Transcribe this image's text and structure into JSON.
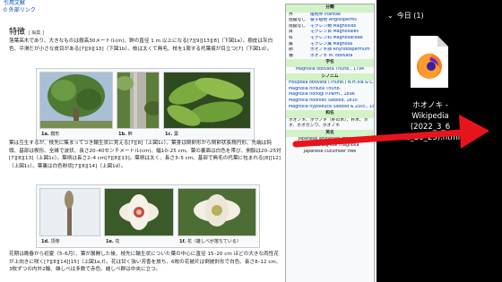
{
  "top_links": [
    "引用文献",
    "0 外部リンク"
  ],
  "section": {
    "title": "特徴",
    "edit": "[ 編集 ]"
  },
  "paragraphs": {
    "p1": "落葉高木であり、大きなものは樹高30メートル(m)、幹の直径 1 m 以上になる[7][9][13][8]（下図1a）。樹皮は灰白色、平滑だが小さな皮目がある[7][9][13]（下図1b）。枝は太くて無毛、枝を1周する托葉痕が目立つ[7]（下図1d）。",
    "p2": "葉は互生するが、枝先に集まってつき輪生状に見える[7][8]（上図1c）。葉身は倒卵形から倒卵状長楕円形、先端は鈍頭、基部は楔形、全縁で波状、長さ20–40センチメートル(cm)、幅10–25 cm。葉の裏面は白色を帯び、側脈は20–25対[7][8][13]（上図1c）。葉柄は長さ2–4 cm[7][8][13]。葉柄は太く、長さ3–5 cm、基部で無毛の托葉に包まれる[8][12]（上図1c）。葉裏は白色粉状[7][8][14]（上図1d）。",
    "p3": "花期は晩春から初夏（5–6月）、葉が展開した後、枝先に輪生状についた葉の中心に直径 15–20 cm ほどの大きな両性花が上向きに咲く[7][8][14][15]（上図1e,f）。花は甘く強い芳香を放ち、6枚の花被片は倒披針形で白色、長さ8–12 cm、3枚ずつの内外2輪、雄しべは多数で赤色、雌しべ群は中央に立つ。"
  },
  "figures_row1": [
    {
      "id": "1a.",
      "label": "樹形"
    },
    {
      "id": "1b.",
      "label": "幹"
    },
    {
      "id": "1c.",
      "label": "葉"
    }
  ],
  "figures_row2": [
    {
      "id": "1d.",
      "label": "頂芽"
    },
    {
      "id": "1e.",
      "label": "花"
    },
    {
      "id": "1f.",
      "label": "花（雄しべが落ちている）"
    }
  ],
  "infobox": {
    "h_class": "分類",
    "rows": [
      {
        "k": "界",
        "v": "植物界 Plantae"
      },
      {
        "k": "階級なし",
        "v": "被子植物 Angiosperms"
      },
      {
        "k": "階級なし",
        "v": "モクレン類 Magnoliids"
      },
      {
        "k": "目",
        "v": "モクレン目 Magnoliales"
      },
      {
        "k": "科",
        "v": "モクレン科 Magnoliaceae"
      },
      {
        "k": "属",
        "v": "モクレン属 Magnolia"
      },
      {
        "k": "節",
        "v": "ホオノキ節 Rhytidospermum"
      },
      {
        "k": "種",
        "v": "ホオノキ M. obovata"
      }
    ],
    "h_sci": "学名",
    "sci": "Magnolia obovata Thunb., 1794",
    "h_syn": "シノニム",
    "syn": [
      "Houpoea obovata (Thunb.) N.H.Xia & C.Y.Wu, 2008",
      "Magnolia hirsuta Thunb.",
      "Magnolia honogi P.Parm., 1896",
      "Magnolia hoonoki Siebold, 1830",
      "Magnolia hypoleuca Siebold & Zucc., 1845"
    ],
    "h_ja": "和名",
    "ja": "ホオノキ、ホウノキ（朴の木）、朴木、ホオ、ホオガシワ、ホオノキ",
    "h_en": "英名",
    "en": [
      "Japanese whitebark magnolia",
      "Japanese big leaf magnolia",
      "Japanese cucumber tree"
    ]
  },
  "panel": {
    "group": "今日 (1)",
    "chevron": "⌄",
    "file_name": "ホオノキ - Wikipedia (2022_3_6 22_20_23).html"
  },
  "colors": {
    "link": "#0645ad",
    "infobox_head": "#d3f2c8",
    "arrow": "#e8141b"
  }
}
